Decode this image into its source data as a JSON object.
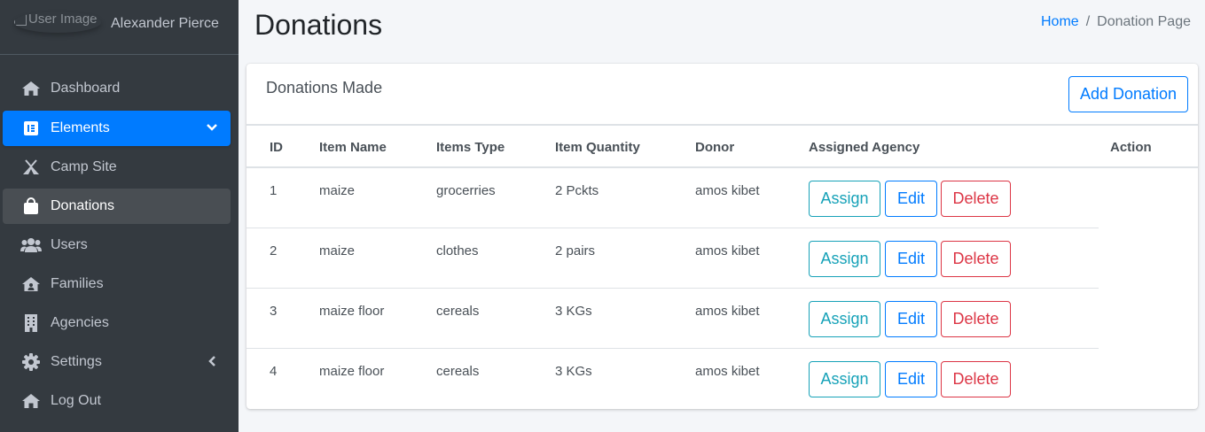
{
  "sidebar": {
    "user": {
      "img_alt": "User Image",
      "name": "Alexander Pierce"
    },
    "items": [
      {
        "label": "Dashboard",
        "icon": "home-icon"
      },
      {
        "label": "Elements",
        "icon": "elementor-icon"
      },
      {
        "label": "Camp Site",
        "icon": "campground-icon"
      },
      {
        "label": "Donations",
        "icon": "shopping-bag-icon"
      },
      {
        "label": "Users",
        "icon": "users-icon"
      },
      {
        "label": "Families",
        "icon": "house-user-icon"
      },
      {
        "label": "Agencies",
        "icon": "building-icon"
      },
      {
        "label": "Settings",
        "icon": "cog-icon"
      },
      {
        "label": "Log Out",
        "icon": "home-icon"
      }
    ]
  },
  "header": {
    "title": "Donations",
    "breadcrumb": {
      "home": "Home",
      "separator": "/",
      "current": "Donation Page"
    }
  },
  "card": {
    "title": "Donations Made",
    "add_button": "Add Donation",
    "columns": [
      "ID",
      "Item Name",
      "Items Type",
      "Item Quantity",
      "Donor",
      "Assigned Agency",
      "Action"
    ],
    "rows": [
      {
        "id": "1",
        "item_name": "maize",
        "items_type": "grocerries",
        "quantity": "2 Pckts",
        "donor": "amos kibet"
      },
      {
        "id": "2",
        "item_name": "maize",
        "items_type": "clothes",
        "quantity": "2 pairs",
        "donor": "amos kibet"
      },
      {
        "id": "3",
        "item_name": "maize floor",
        "items_type": "cereals",
        "quantity": "3 KGs",
        "donor": "amos kibet"
      },
      {
        "id": "4",
        "item_name": "maize floor",
        "items_type": "cereals",
        "quantity": "3 KGs",
        "donor": "amos kibet"
      }
    ],
    "actions": {
      "assign": "Assign",
      "edit": "Edit",
      "delete": "Delete"
    }
  },
  "colors": {
    "sidebar_bg": "#343a40",
    "primary": "#007bff",
    "info": "#17a2b8",
    "danger": "#dc3545",
    "page_bg": "#f4f6f9"
  }
}
